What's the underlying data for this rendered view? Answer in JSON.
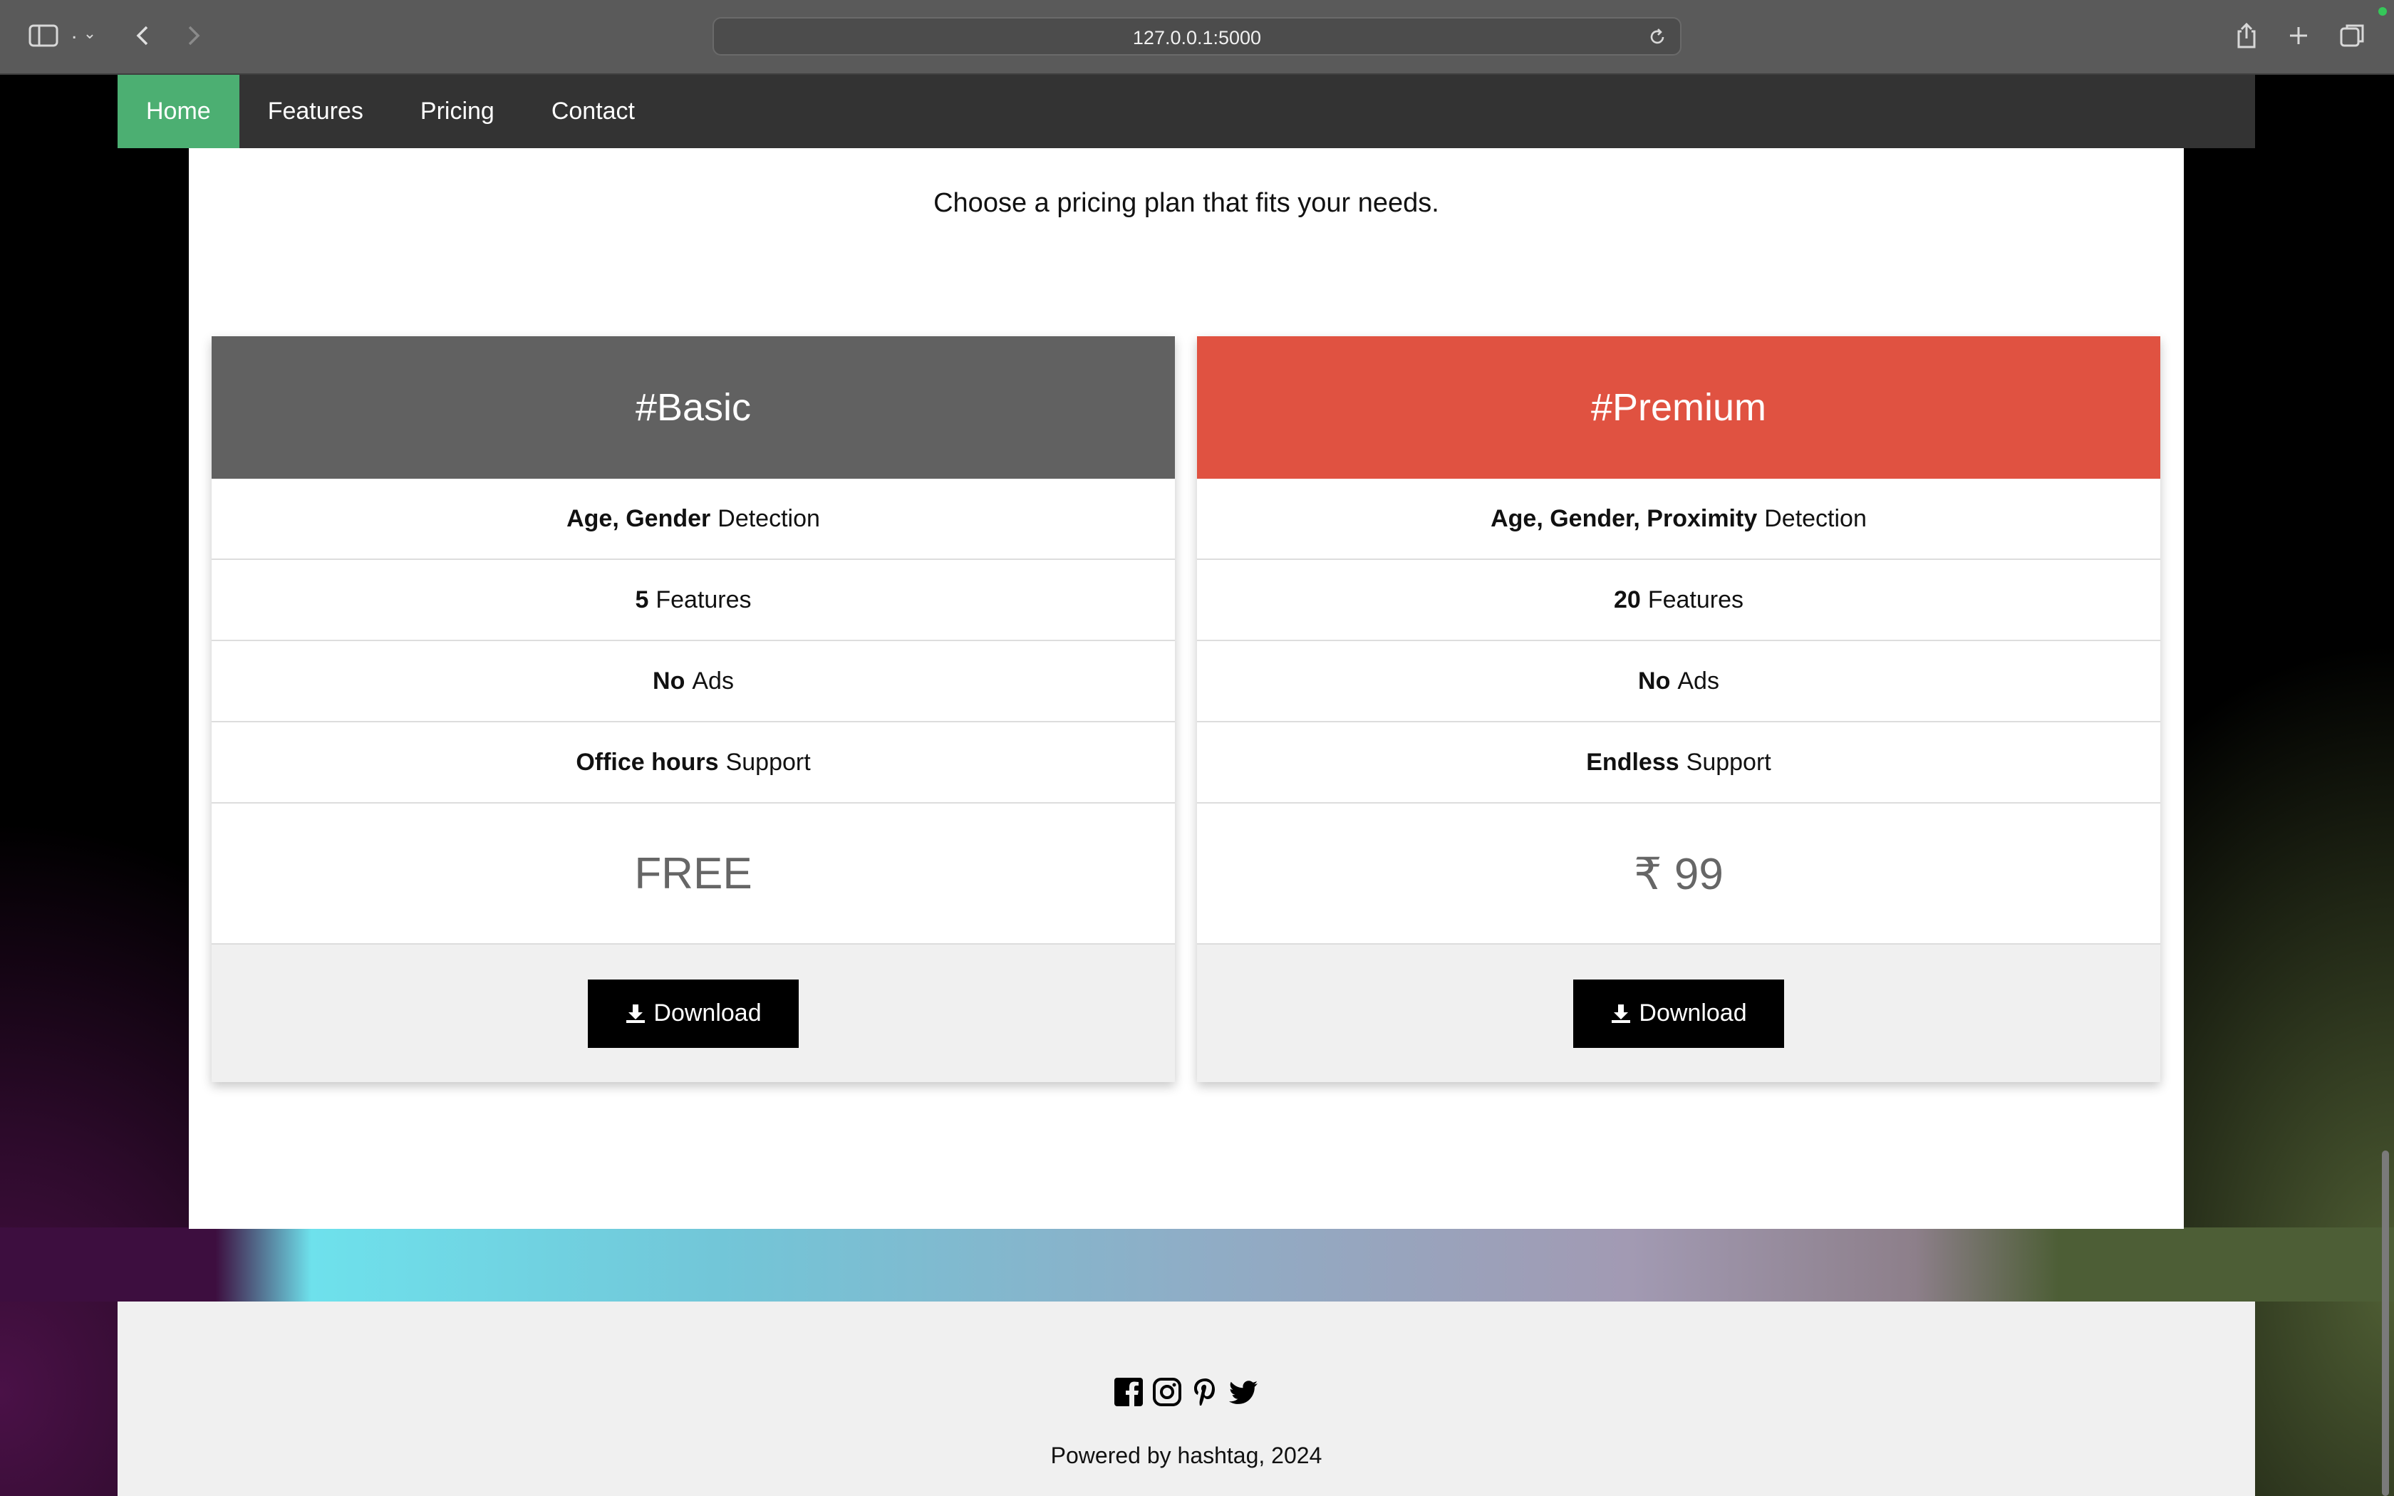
{
  "browser": {
    "url": "127.0.0.1:5000",
    "tab_indicator": "."
  },
  "nav": {
    "items": [
      {
        "label": "Home",
        "active": true
      },
      {
        "label": "Features",
        "active": false
      },
      {
        "label": "Pricing",
        "active": false
      },
      {
        "label": "Contact",
        "active": false
      }
    ]
  },
  "pricing": {
    "subtitle": "Choose a pricing plan that fits your needs.",
    "plans": [
      {
        "name": "#Basic",
        "header_color": "#616161",
        "features": [
          {
            "bold": "Age, Gender",
            "text": "Detection"
          },
          {
            "bold": "5",
            "text": "Features"
          },
          {
            "bold": "No",
            "text": "Ads"
          },
          {
            "bold": "Office hours",
            "text": "Support"
          }
        ],
        "price": "FREE",
        "button_label": "Download"
      },
      {
        "name": "#Premium",
        "header_color": "#e05241",
        "features": [
          {
            "bold": "Age, Gender, Proximity",
            "text": "Detection"
          },
          {
            "bold": "20",
            "text": "Features"
          },
          {
            "bold": "No",
            "text": "Ads"
          },
          {
            "bold": "Endless",
            "text": "Support"
          }
        ],
        "price": "₹ 99",
        "button_label": "Download"
      }
    ]
  },
  "footer": {
    "social_icons": [
      "facebook-icon",
      "instagram-icon",
      "pinterest-icon",
      "twitter-icon"
    ],
    "powered_by": "Powered by hashtag, 2024"
  },
  "colors": {
    "nav_active": "#4caf72",
    "nav_bg": "#333333",
    "premium_accent": "#e05241"
  }
}
